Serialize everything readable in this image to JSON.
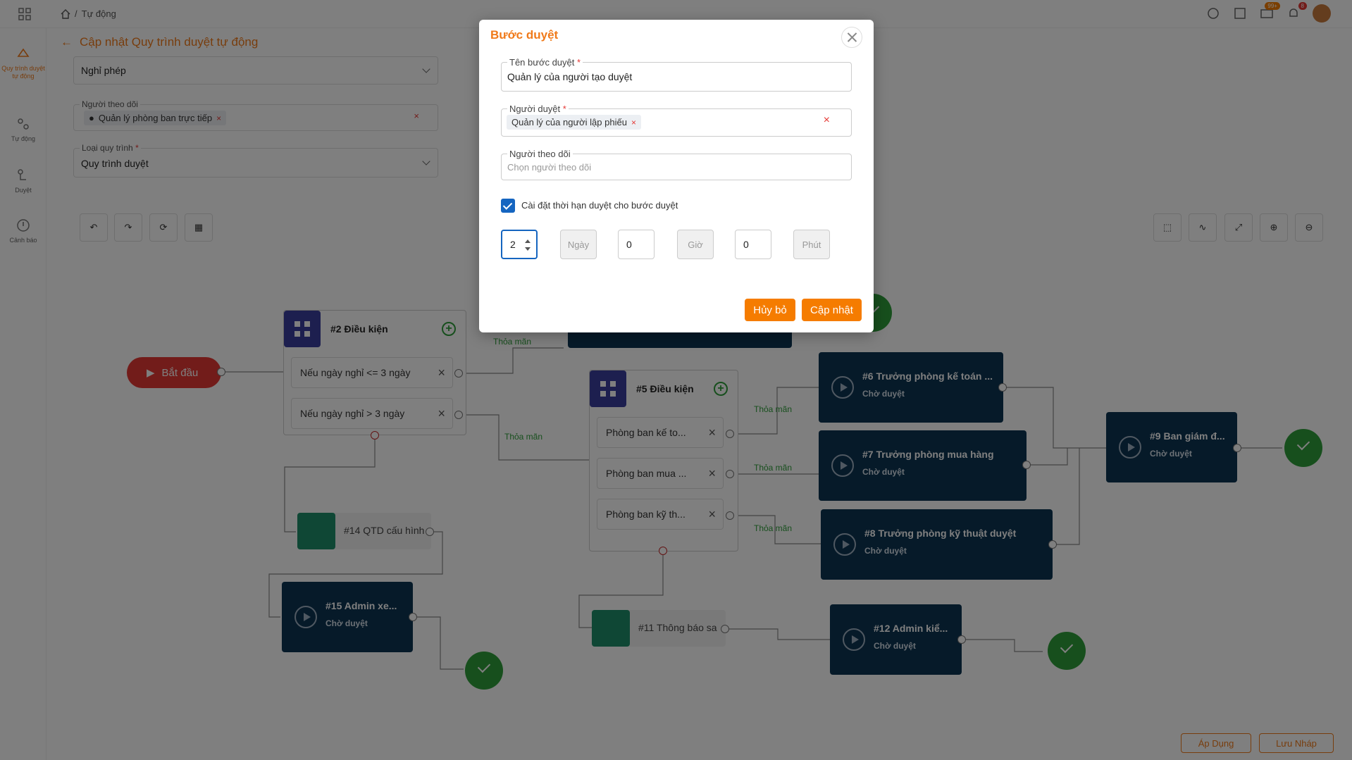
{
  "breadcrumb": {
    "current": "Tự động"
  },
  "top_icons": {
    "badge_mail": "99+",
    "badge_notify": "8"
  },
  "sidebar": {
    "items": [
      {
        "label": "Quy trình duyệt tự động",
        "icon": "workflow-icon"
      },
      {
        "label": "Tự động",
        "icon": "automation-icon"
      },
      {
        "label": "Duyệt",
        "icon": "approval-icon"
      },
      {
        "label": "Cảnh báo",
        "icon": "alert-icon"
      }
    ]
  },
  "page": {
    "title": "Cập nhật Quy trình duyệt tự động",
    "form_type_value": "Nghỉ phép",
    "followers_label": "Người theo dõi",
    "followers_tag": "Quản lý phòng ban trực tiếp",
    "process_type_label": "Loại quy trình",
    "process_type_value": "Quy trình duyệt"
  },
  "flow": {
    "start_label": "Bắt đầu",
    "cond2": {
      "title": "#2 Điều kiện",
      "rows": [
        "Nếu ngày nghỉ <= 3 ngày",
        "Nếu ngày nghỉ > 3 ngày"
      ]
    },
    "cond5": {
      "title": "#5 Điều kiện",
      "rows": [
        "Phòng ban kế to...",
        "Phòng ban mua ...",
        "Phòng ban kỹ th..."
      ]
    },
    "edge_label": "Thỏa mãn",
    "nodes": [
      {
        "title": "#6 Trưởng phòng kế toán ...",
        "status": "Chờ duyệt"
      },
      {
        "title": "#7 Trưởng phòng mua hàng",
        "status": "Chờ duyệt"
      },
      {
        "title": "#8 Trưởng phòng kỹ thuật duyệt",
        "status": "Chờ duyệt"
      },
      {
        "title": "#9 Ban giám đ...",
        "status": "Chờ duyệt"
      },
      {
        "title": "#12 Admin kiể...",
        "status": "Chờ duyệt"
      },
      {
        "title": "#15 Admin xe...",
        "status": "Chờ duyệt"
      }
    ],
    "notify14": "#14 QTD cấu hình",
    "notify11": "#11 Thông báo sa"
  },
  "footer": {
    "apply": "Áp Dụng",
    "draft": "Lưu Nháp"
  },
  "modal": {
    "title": "Bước duyệt",
    "step_name_label": "Tên bước duyệt",
    "step_name_value": "Quản lý của người tạo duyệt",
    "approver_label": "Người duyệt",
    "approver_tag": "Quản lý của người lập phiếu",
    "follower_label": "Người theo dõi",
    "follower_placeholder": "Chọn người theo dõi",
    "deadline_checkbox_label": "Cài đặt thời hạn duyệt cho bước duyệt",
    "days_value": "2",
    "days_unit": "Ngày",
    "hours_value": "0",
    "hours_unit": "Giờ",
    "minutes_value": "0",
    "minutes_unit": "Phút",
    "cancel_label": "Hủy bỏ",
    "update_label": "Cập nhật"
  },
  "colors": {
    "accent": "#f07a1a",
    "node": "#0d3553",
    "success": "#2e9e3a",
    "danger": "#e53935"
  }
}
